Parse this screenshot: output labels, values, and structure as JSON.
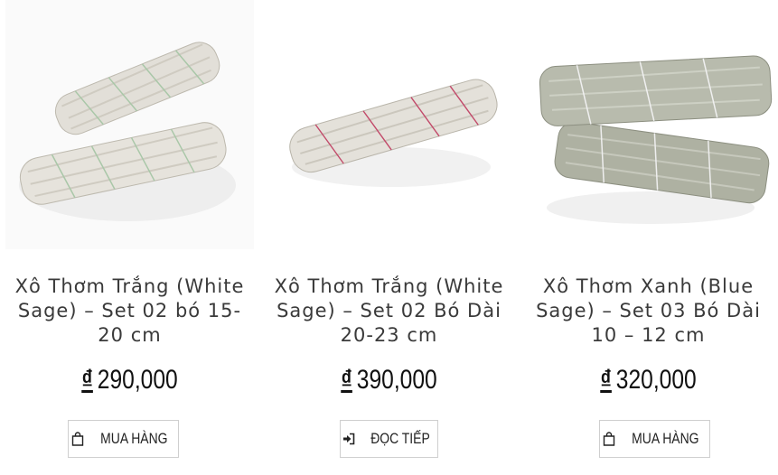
{
  "products": [
    {
      "title": "Xô Thơm Trắng (White Sage) – Set 02 bó 15-20 cm",
      "currency": "₫",
      "price": "290,000",
      "button_label": "MUA HÀNG",
      "button_icon": "shopping-bag-icon"
    },
    {
      "title": "Xô Thơm Trắng (White Sage) – Set 02 Bó Dài 20-23 cm",
      "currency": "₫",
      "price": "390,000",
      "button_label": "ĐỌC TIẾP",
      "button_icon": "sign-in-arrow-icon"
    },
    {
      "title": "Xô Thơm Xanh (Blue Sage) – Set 03 Bó Dài 10 – 12 cm",
      "currency": "₫",
      "price": "320,000",
      "button_label": "MUA HÀNG",
      "button_icon": "shopping-bag-icon"
    }
  ],
  "colors": {
    "white_sage": "#e6e3dc",
    "blue_sage": "#b4b7a8",
    "image_bg": "#fafafa"
  }
}
